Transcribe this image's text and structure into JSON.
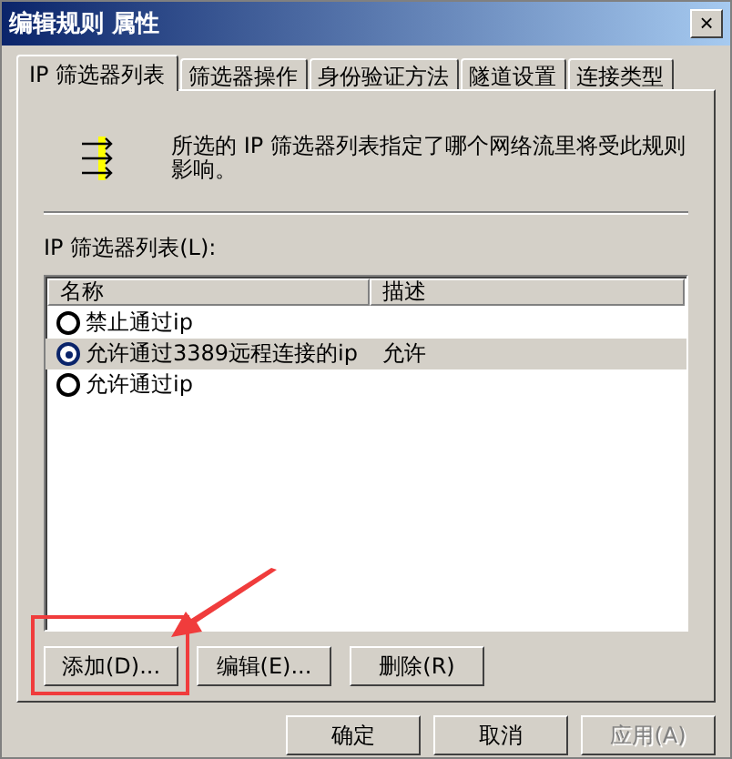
{
  "window": {
    "title": "编辑规则 属性",
    "close": "×"
  },
  "tabs": [
    {
      "label": "IP 筛选器列表",
      "selected": true
    },
    {
      "label": "筛选器操作",
      "selected": false
    },
    {
      "label": "身份验证方法",
      "selected": false
    },
    {
      "label": "隧道设置",
      "selected": false
    },
    {
      "label": "连接类型",
      "selected": false
    }
  ],
  "description": "所选的 IP 筛选器列表指定了哪个网络流里将受此规则影响。",
  "list_label": "IP 筛选器列表(L):",
  "list": {
    "columns": [
      "名称",
      "描述"
    ],
    "rows": [
      {
        "name": "禁止通过ip",
        "description": "",
        "selected": false
      },
      {
        "name": "允许通过3389远程连接的ip",
        "description": "允许",
        "selected": true
      },
      {
        "name": "允许通过ip",
        "description": "",
        "selected": false
      }
    ]
  },
  "list_buttons": [
    {
      "label": "添加(D)...",
      "highlighted": true
    },
    {
      "label": "编辑(E)...",
      "highlighted": false
    },
    {
      "label": "删除(R)",
      "highlighted": false
    }
  ],
  "dialog_buttons": [
    {
      "label": "确定",
      "disabled": false
    },
    {
      "label": "取消",
      "disabled": false
    },
    {
      "label": "应用(A)",
      "disabled": true
    }
  ]
}
